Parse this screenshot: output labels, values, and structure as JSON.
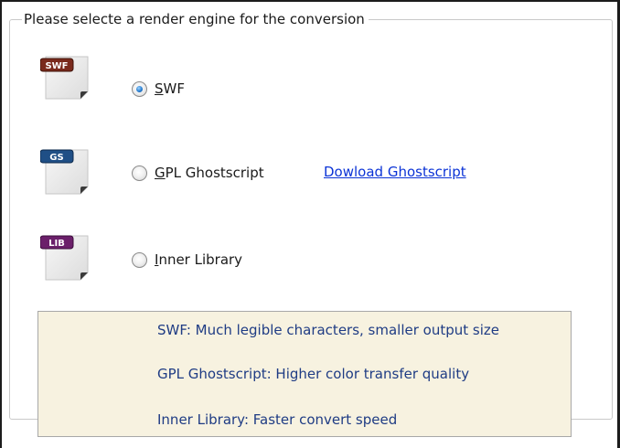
{
  "group": {
    "title": "Please selecte a render engine for the conversion"
  },
  "engines": [
    {
      "badge": "SWF",
      "badge_color": "#7a2a1c",
      "label": "SWF",
      "mnemonic": "S",
      "rest": "WF",
      "selected": true
    },
    {
      "badge": "GS",
      "badge_color": "#1f4f86",
      "label": "GPL Ghostscript",
      "mnemonic": "G",
      "rest": "PL Ghostscript",
      "selected": false,
      "link": "Dowload Ghostscript"
    },
    {
      "badge": "LIB",
      "badge_color": "#6b1f6a",
      "label": "Inner Library",
      "mnemonic": "I",
      "rest": "nner Library",
      "selected": false
    }
  ],
  "info": {
    "lines": [
      "SWF: Much legible characters, smaller output size",
      "GPL Ghostscript: Higher color transfer quality",
      "Inner Library: Faster convert speed"
    ]
  },
  "colors": {
    "link": "#0b33d6",
    "info_text": "#1f3c84",
    "info_background": "#f7f2e0"
  }
}
